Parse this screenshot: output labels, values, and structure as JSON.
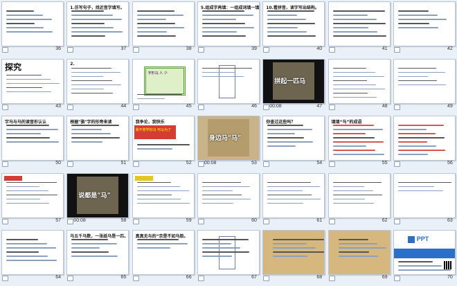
{
  "colors": {
    "background": "#eaf0f7",
    "accent_red": "#d43d33",
    "frame_green": "#5a9c3c"
  },
  "slides": [
    {
      "num": "36",
      "type": "text",
      "title": "",
      "lines": 6
    },
    {
      "num": "37",
      "type": "text",
      "title": "1.仿写句子，找近音字填写。",
      "lines": 7
    },
    {
      "num": "38",
      "type": "text",
      "title": "",
      "lines": 7
    },
    {
      "num": "39",
      "type": "text",
      "title": "5.组成字再填：一组成词填一填。",
      "lines": 7
    },
    {
      "num": "40",
      "type": "text",
      "title": "10.看拼音，读字写出结构。",
      "lines": 7
    },
    {
      "num": "41",
      "type": "text",
      "title": "",
      "lines": 7
    },
    {
      "num": "42",
      "type": "text",
      "title": "",
      "lines": 5
    },
    {
      "num": "43",
      "type": "heading",
      "big": "探究",
      "lines": 5
    },
    {
      "num": "44",
      "type": "text",
      "title": "2.",
      "lines": 7
    },
    {
      "num": "45",
      "type": "frame",
      "frame_text": "字形马  人 少",
      "lines": 3
    },
    {
      "num": "46",
      "type": "diagram",
      "title": "",
      "lines": 3
    },
    {
      "num": "47",
      "type": "video",
      "banner": "拼起一匹马",
      "time": "00:08"
    },
    {
      "num": "48",
      "type": "text",
      "title": "",
      "lines": 8
    },
    {
      "num": "49",
      "type": "text",
      "title": "",
      "lines": 5
    },
    {
      "num": "50",
      "type": "text",
      "title": "字马与马的读音形认认",
      "lines": 5
    },
    {
      "num": "51",
      "type": "text",
      "title": "根据\"骆\"字的形旁来读",
      "lines": 5
    },
    {
      "num": "52",
      "type": "redbox",
      "title": "我争论，我快乐",
      "red_text": "我不管学好马 可以为了",
      "lines": 2
    },
    {
      "num": "53",
      "type": "photo",
      "banner": "身边马“马”",
      "time": "00:08"
    },
    {
      "num": "54",
      "type": "table",
      "title": "你查过这些吗？",
      "lines": 6
    },
    {
      "num": "55",
      "type": "grid",
      "title": "填填“马”的成语",
      "lines": 8
    },
    {
      "num": "56",
      "type": "grid",
      "title": "",
      "lines": 8
    },
    {
      "num": "57",
      "type": "colored",
      "title": "",
      "lines": 6
    },
    {
      "num": "58",
      "type": "video",
      "banner": "说都是“马”",
      "time": "00:08"
    },
    {
      "num": "59",
      "type": "yellowtitle",
      "title": "",
      "lines": 6
    },
    {
      "num": "60",
      "type": "text",
      "title": "",
      "lines": 6
    },
    {
      "num": "61",
      "type": "text",
      "title": "",
      "lines": 6
    },
    {
      "num": "62",
      "type": "text",
      "title": "",
      "lines": 6
    },
    {
      "num": "63",
      "type": "ad",
      "title": "",
      "lines": 3
    },
    {
      "num": "64",
      "type": "text",
      "title": "",
      "lines": 6
    },
    {
      "num": "65",
      "type": "text",
      "title": "马五千马数，一张纸马是一匹。",
      "lines": 5
    },
    {
      "num": "66",
      "type": "text",
      "title": "真真无与的“京是不如马脸。",
      "lines": 3
    },
    {
      "num": "67",
      "type": "diagram",
      "title": "",
      "lines": 5
    },
    {
      "num": "68",
      "type": "scroll",
      "title": "",
      "lines": 5
    },
    {
      "num": "69",
      "type": "scroll",
      "title": "",
      "lines": 5
    },
    {
      "num": "70",
      "type": "ppt",
      "logo": "PPT",
      "title": "",
      "lines": 4
    }
  ]
}
